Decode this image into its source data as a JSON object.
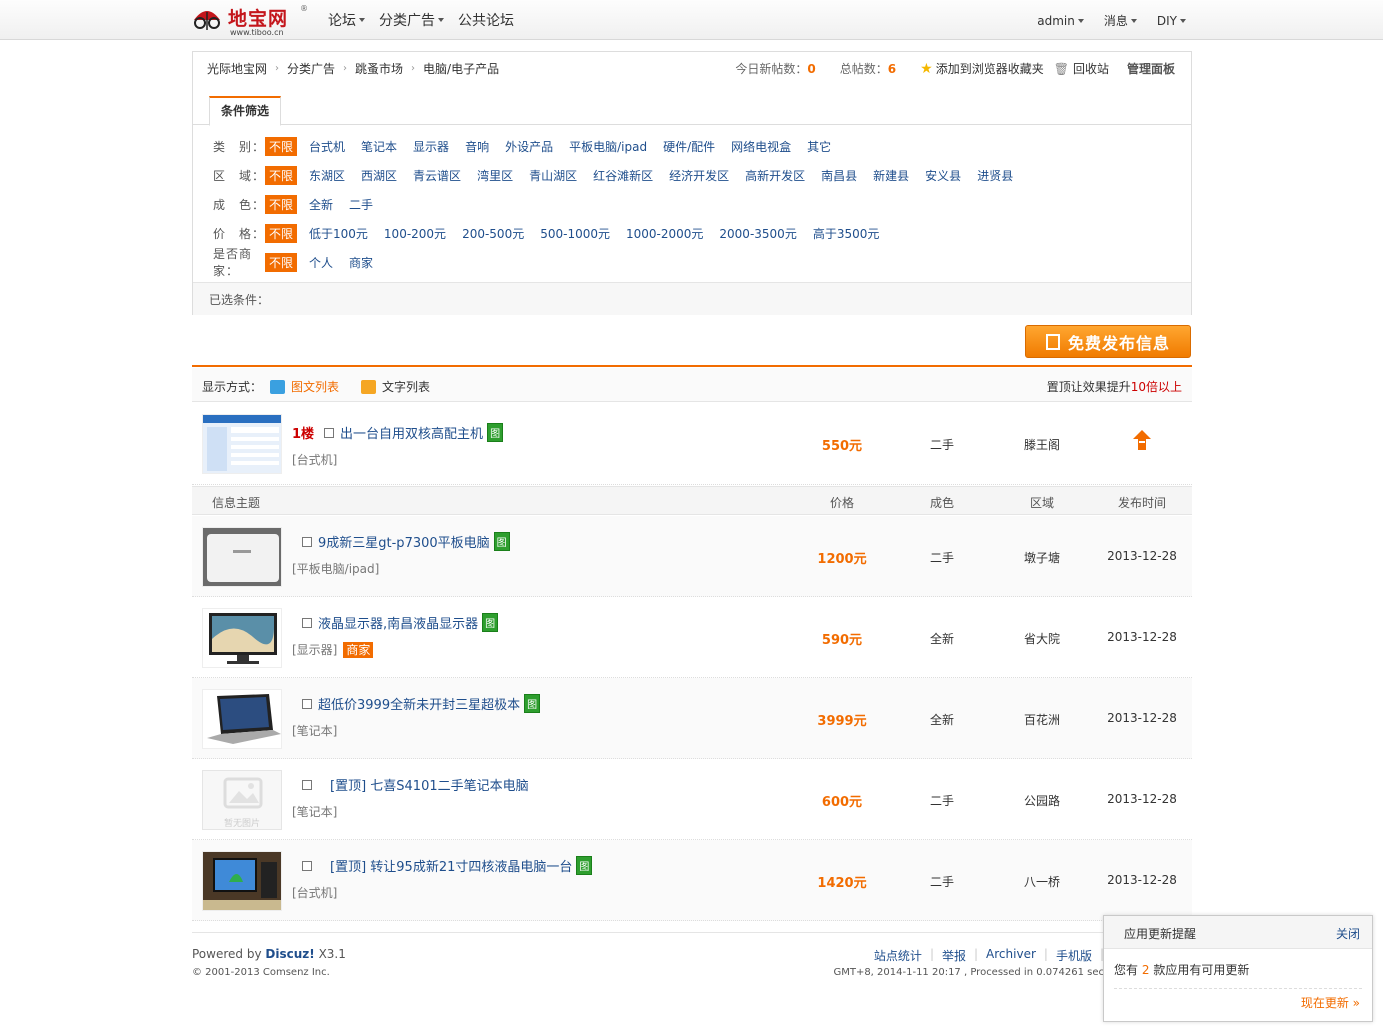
{
  "header": {
    "logo_text": "地宝网",
    "logo_url_text": "www.tiboo.cn",
    "logo_reg": "®",
    "nav": [
      "论坛",
      "分类广告",
      "公共论坛"
    ],
    "user": "admin",
    "messages": "消息",
    "diy": "DIY"
  },
  "breadcrumb": [
    "光际地宝网",
    "分类广告",
    "跳蚤市场",
    "电脑/电子产品"
  ],
  "stats": {
    "today_label": "今日新帖数：",
    "today_value": "0",
    "total_label": "总帖数：",
    "total_value": "6",
    "bookmark": "添加到浏览器收藏夹",
    "recycle": "回收站",
    "admin_panel": "管理面板"
  },
  "filter": {
    "tab": "条件筛选",
    "nolimit": "不限",
    "rows": [
      {
        "label": "类　别：",
        "options": [
          "台式机",
          "笔记本",
          "显示器",
          "音响",
          "外设产品",
          "平板电脑/ipad",
          "硬件/配件",
          "网络电视盒",
          "其它"
        ]
      },
      {
        "label": "区　域：",
        "options": [
          "东湖区",
          "西湖区",
          "青云谱区",
          "湾里区",
          "青山湖区",
          "红谷滩新区",
          "经济开发区",
          "高新开发区",
          "南昌县",
          "新建县",
          "安义县",
          "进贤县"
        ]
      },
      {
        "label": "成　色：",
        "options": [
          "全新",
          "二手"
        ]
      },
      {
        "label": "价　格：",
        "options": [
          "低于100元",
          "100-200元",
          "200-500元",
          "500-1000元",
          "1000-2000元",
          "2000-3500元",
          "高于3500元"
        ]
      },
      {
        "label": "是否商家：",
        "options": [
          "个人",
          "商家"
        ]
      }
    ],
    "selected_label": "已选条件："
  },
  "post_button": "免费发布信息",
  "view": {
    "label": "显示方式：",
    "mode1": "图文列表",
    "mode2": "文字列表",
    "promo_prefix": "置顶让效果提升",
    "promo_highlight": "10倍以上"
  },
  "columns": {
    "subject": "信息主题",
    "price": "价格",
    "condition": "成色",
    "area": "区域",
    "date": "发布时间"
  },
  "top_post": {
    "floor": "1楼",
    "title": "出一台自用双核高配主机",
    "tu": "图",
    "category": "[台式机]",
    "price": "550元",
    "condition": "二手",
    "area": "滕王阁"
  },
  "listings": [
    {
      "title": "9成新三星gt-p7300平板电脑",
      "tu": "图",
      "category": "[平板电脑/ipad]",
      "merchant": "",
      "price": "1200元",
      "condition": "二手",
      "area": "墩子塘",
      "date": "2013-12-28"
    },
    {
      "title": "液晶显示器,南昌液晶显示器",
      "tu": "图",
      "category": "[显示器]",
      "merchant": "商家",
      "price": "590元",
      "condition": "全新",
      "area": "省大院",
      "date": "2013-12-28"
    },
    {
      "title": "超低价3999全新未开封三星超极本",
      "tu": "图",
      "category": "[笔记本]",
      "merchant": "",
      "price": "3999元",
      "condition": "全新",
      "area": "百花洲",
      "date": "2013-12-28"
    },
    {
      "title": "[置顶] 七喜S4101二手笔记本电脑",
      "tu": "",
      "category": "[笔记本]",
      "merchant": "",
      "price": "600元",
      "condition": "二手",
      "area": "公园路",
      "date": "2013-12-28",
      "noimg": "暂无图片"
    },
    {
      "title": "[置顶] 转让95成新21寸四核液晶电脑一台",
      "tu": "图",
      "category": "[台式机]",
      "merchant": "",
      "price": "1420元",
      "condition": "二手",
      "area": "八一桥",
      "date": "2013-12-28"
    }
  ],
  "footer": {
    "powered": "Powered by",
    "discuz": "Discuz!",
    "version": "X3.1",
    "copyright": "© 2001-2013 Comsenz Inc.",
    "links": [
      "站点统计",
      "举报",
      "Archiver",
      "手机版"
    ],
    "gmt": "GMT+8, 2014-1-11 20:17 , Processed in 0.074261 sec"
  },
  "popup": {
    "title": "应用更新提醒",
    "close": "关闭",
    "msg_prefix": "您有",
    "count": "2",
    "msg_suffix": "款应用有可用更新",
    "update_now": "现在更新 »"
  }
}
